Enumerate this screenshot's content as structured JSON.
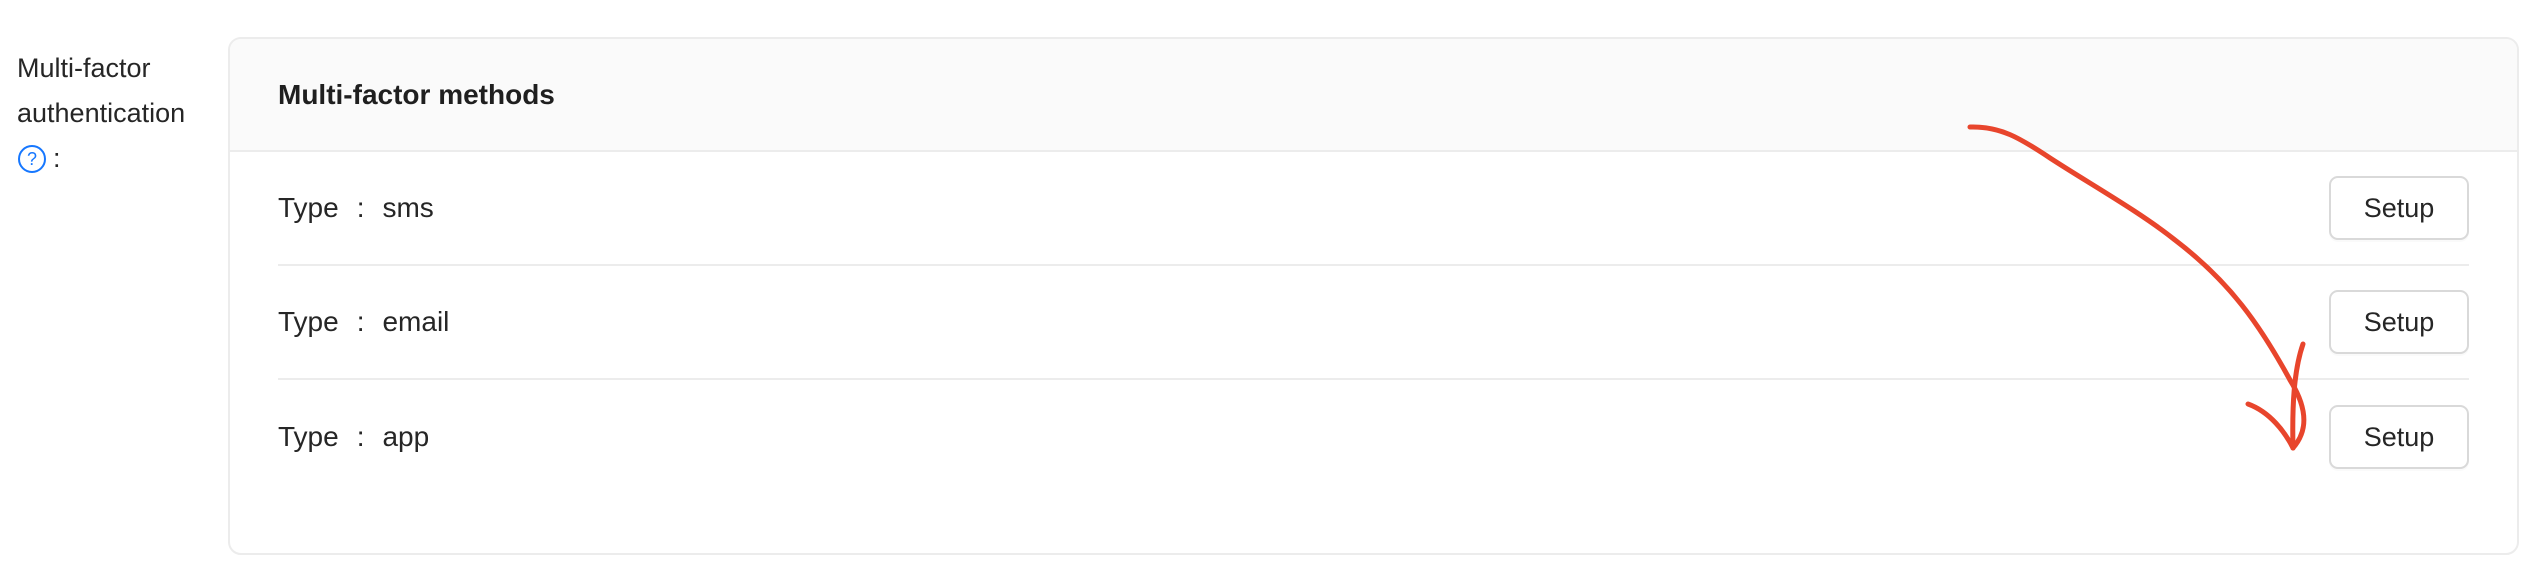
{
  "field": {
    "label_line1": "Multi-factor",
    "label_line2": "authentication",
    "colon": ":"
  },
  "card": {
    "title": "Multi-factor methods",
    "methods": [
      {
        "key": "Type",
        "separator": ":",
        "value": "sms",
        "button_label": "Setup"
      },
      {
        "key": "Type",
        "separator": ":",
        "value": "email",
        "button_label": "Setup"
      },
      {
        "key": "Type",
        "separator": ":",
        "value": "app",
        "button_label": "Setup"
      }
    ]
  },
  "colors": {
    "help_icon": "#1677ff",
    "annotation_arrow": "#e8452c",
    "border": "#ececec",
    "header_bg": "#fafafa"
  },
  "icons": {
    "help": "question-circle-icon",
    "annotation": "hand-drawn-arrow"
  }
}
